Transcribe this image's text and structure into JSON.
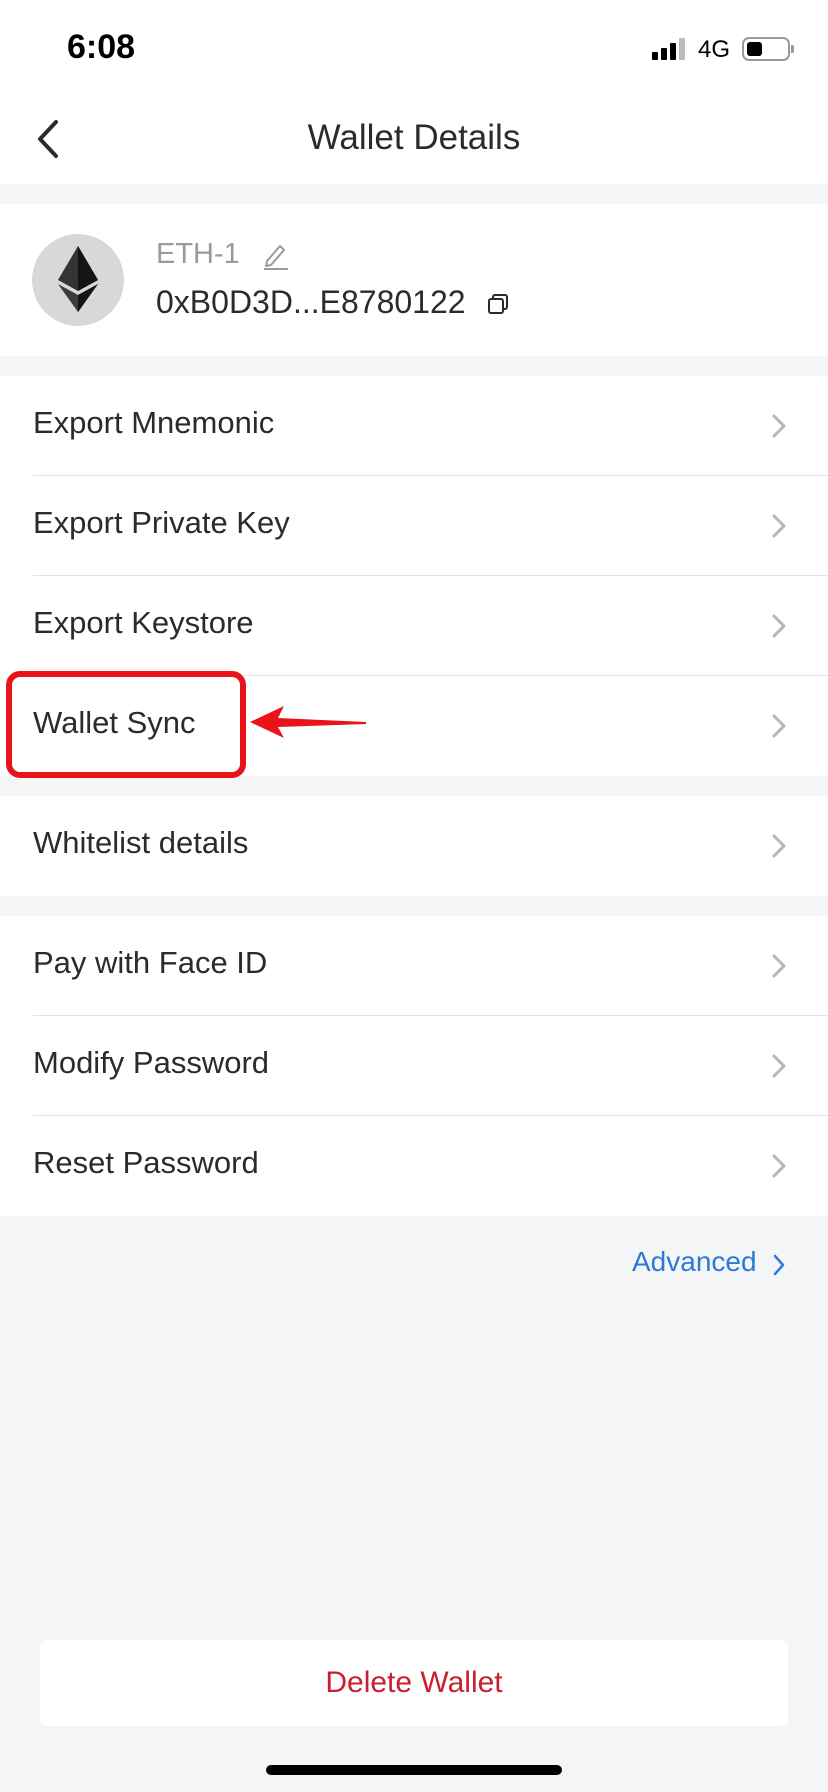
{
  "status_bar": {
    "time": "6:08",
    "network": "4G"
  },
  "header": {
    "title": "Wallet Details"
  },
  "wallet": {
    "name": "ETH-1",
    "address": "0xB0D3D...E8780122"
  },
  "groups": [
    {
      "items": [
        {
          "label": "Export Mnemonic"
        },
        {
          "label": "Export Private Key"
        },
        {
          "label": "Export Keystore"
        },
        {
          "label": "Wallet Sync"
        }
      ]
    },
    {
      "items": [
        {
          "label": "Whitelist details"
        }
      ]
    },
    {
      "items": [
        {
          "label": "Pay with Face ID"
        },
        {
          "label": "Modify Password"
        },
        {
          "label": "Reset Password"
        }
      ]
    }
  ],
  "advanced": {
    "label": "Advanced"
  },
  "delete": {
    "label": "Delete Wallet"
  },
  "colors": {
    "accent_link": "#2a7ad6",
    "danger": "#c8202e",
    "annotation": "#e8141a"
  }
}
